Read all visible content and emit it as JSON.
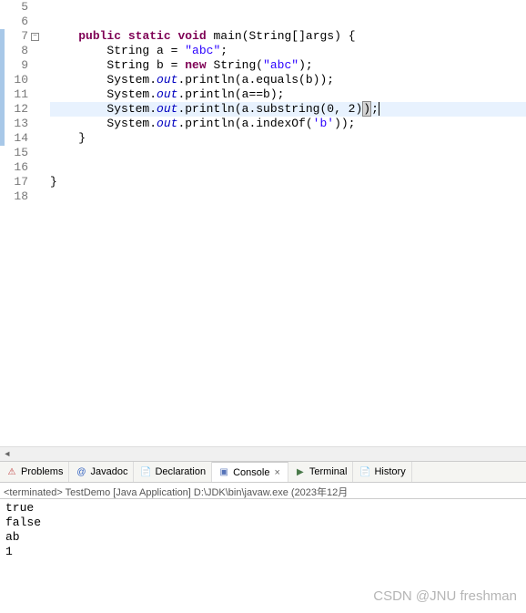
{
  "editor": {
    "lines": [
      {
        "num": 5,
        "marker": false,
        "tokens": []
      },
      {
        "num": 6,
        "marker": false,
        "tokens": []
      },
      {
        "num": 7,
        "marker": true,
        "fold": true,
        "tokens": [
          {
            "t": "    ",
            "c": ""
          },
          {
            "t": "public",
            "c": "kw"
          },
          {
            "t": " ",
            "c": ""
          },
          {
            "t": "static",
            "c": "kw"
          },
          {
            "t": " ",
            "c": ""
          },
          {
            "t": "void",
            "c": "kw"
          },
          {
            "t": " main(String[]args) {",
            "c": ""
          }
        ]
      },
      {
        "num": 8,
        "marker": true,
        "tokens": [
          {
            "t": "        String a = ",
            "c": ""
          },
          {
            "t": "\"abc\"",
            "c": "str"
          },
          {
            "t": ";",
            "c": ""
          }
        ]
      },
      {
        "num": 9,
        "marker": true,
        "tokens": [
          {
            "t": "        String b = ",
            "c": ""
          },
          {
            "t": "new",
            "c": "kw"
          },
          {
            "t": " String(",
            "c": ""
          },
          {
            "t": "\"abc\"",
            "c": "str"
          },
          {
            "t": ");",
            "c": ""
          }
        ]
      },
      {
        "num": 10,
        "marker": true,
        "tokens": [
          {
            "t": "        System.",
            "c": ""
          },
          {
            "t": "out",
            "c": "field"
          },
          {
            "t": ".println(a.equals(b));",
            "c": ""
          }
        ]
      },
      {
        "num": 11,
        "marker": true,
        "tokens": [
          {
            "t": "        System.",
            "c": ""
          },
          {
            "t": "out",
            "c": "field"
          },
          {
            "t": ".println(a==b);",
            "c": ""
          }
        ]
      },
      {
        "num": 12,
        "marker": true,
        "hl": true,
        "tokens": [
          {
            "t": "        System.",
            "c": ""
          },
          {
            "t": "out",
            "c": "field"
          },
          {
            "t": ".println(a.substring(0, 2)",
            "c": ""
          },
          {
            "t": ")",
            "c": "paren-hl"
          },
          {
            "t": ";",
            "c": ""
          },
          {
            "t": "",
            "c": "cursor"
          }
        ]
      },
      {
        "num": 13,
        "marker": true,
        "tokens": [
          {
            "t": "        System.",
            "c": ""
          },
          {
            "t": "out",
            "c": "field"
          },
          {
            "t": ".println(a.indexOf(",
            "c": ""
          },
          {
            "t": "'b'",
            "c": "str"
          },
          {
            "t": "));",
            "c": ""
          }
        ]
      },
      {
        "num": 14,
        "marker": true,
        "tokens": [
          {
            "t": "    }",
            "c": ""
          }
        ]
      },
      {
        "num": 15,
        "marker": false,
        "tokens": []
      },
      {
        "num": 16,
        "marker": false,
        "tokens": []
      },
      {
        "num": 17,
        "marker": false,
        "tokens": [
          {
            "t": "}",
            "c": ""
          }
        ]
      },
      {
        "num": 18,
        "marker": false,
        "tokens": []
      }
    ]
  },
  "tabs": [
    {
      "id": "problems",
      "label": "Problems",
      "icon": "problems-icon",
      "glyph": "⚠",
      "color": "#c04040",
      "active": false
    },
    {
      "id": "javadoc",
      "label": "Javadoc",
      "icon": "javadoc-icon",
      "glyph": "@",
      "color": "#3060c0",
      "active": false
    },
    {
      "id": "declaration",
      "label": "Declaration",
      "icon": "declaration-icon",
      "glyph": "📄",
      "color": "#9a7a2a",
      "active": false
    },
    {
      "id": "console",
      "label": "Console",
      "icon": "console-icon",
      "glyph": "▣",
      "color": "#5573b8",
      "active": true,
      "closable": true
    },
    {
      "id": "terminal",
      "label": "Terminal",
      "icon": "terminal-icon",
      "glyph": "▶",
      "color": "#4a7a4a",
      "active": false
    },
    {
      "id": "history",
      "label": "History",
      "icon": "history-icon",
      "glyph": "📄",
      "color": "#9a7a2a",
      "active": false
    }
  ],
  "status": "<terminated> TestDemo [Java Application] D:\\JDK\\bin\\javaw.exe  (2023年12月",
  "console_output": [
    "true",
    "false",
    "ab",
    "1"
  ],
  "watermark": "CSDN @JNU freshman"
}
